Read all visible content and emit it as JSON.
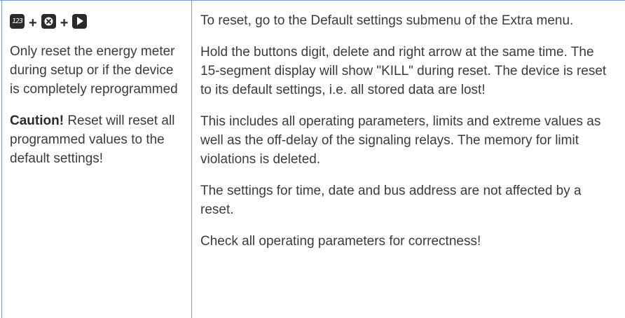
{
  "keys": {
    "digit_key_glyph": "123",
    "delete_key_glyph": "✖",
    "plus": "+",
    "icon_names": [
      "digit-key-icon",
      "delete-key-icon",
      "right-arrow-key-icon"
    ]
  },
  "left": {
    "note": "Only reset the energy meter during setup or if the device is completely reprogrammed",
    "caution_label": "Caution!",
    "caution_text": "Reset will reset all programmed values to the default settings!"
  },
  "right": {
    "paragraphs": [
      "To reset, go to the Default settings submenu of the Extra menu.",
      "Hold the buttons digit, delete and right arrow at the same time. The 15-segment display will show \"KILL\" during reset. The device is reset to its default settings, i.e. all stored data are lost!",
      "This includes all operating parameters, limits and extreme values as well as the off-delay of the signaling relays. The memory for limit violations is deleted.",
      "The settings for time, date and bus address are not affected by a reset.",
      "Check all operating parameters for correctness!"
    ]
  },
  "colors": {
    "rule": "#7a9cc6",
    "text": "#3b3b3b",
    "key": "#2b2b2b"
  }
}
